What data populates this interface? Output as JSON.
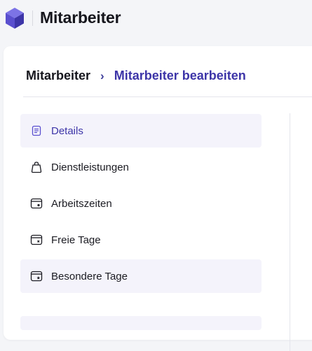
{
  "app": {
    "title": "Mitarbeiter",
    "brand_color": "#5a4fcf"
  },
  "breadcrumb": {
    "root": "Mitarbeiter",
    "separator": "›",
    "current": "Mitarbeiter bearbeiten"
  },
  "nav": {
    "items": [
      {
        "label": "Details",
        "icon": "document-lines-icon",
        "active": true
      },
      {
        "label": "Dienstleistungen",
        "icon": "shopping-bag-icon",
        "active": false
      },
      {
        "label": "Arbeitszeiten",
        "icon": "calendar-clock-icon",
        "active": false
      },
      {
        "label": "Freie Tage",
        "icon": "calendar-x-icon",
        "active": false
      },
      {
        "label": "Besondere Tage",
        "icon": "calendar-star-icon",
        "active": false
      }
    ]
  },
  "colors": {
    "accent": "#3d35a8",
    "active_bg": "#f4f3fb",
    "text": "#16161d"
  }
}
